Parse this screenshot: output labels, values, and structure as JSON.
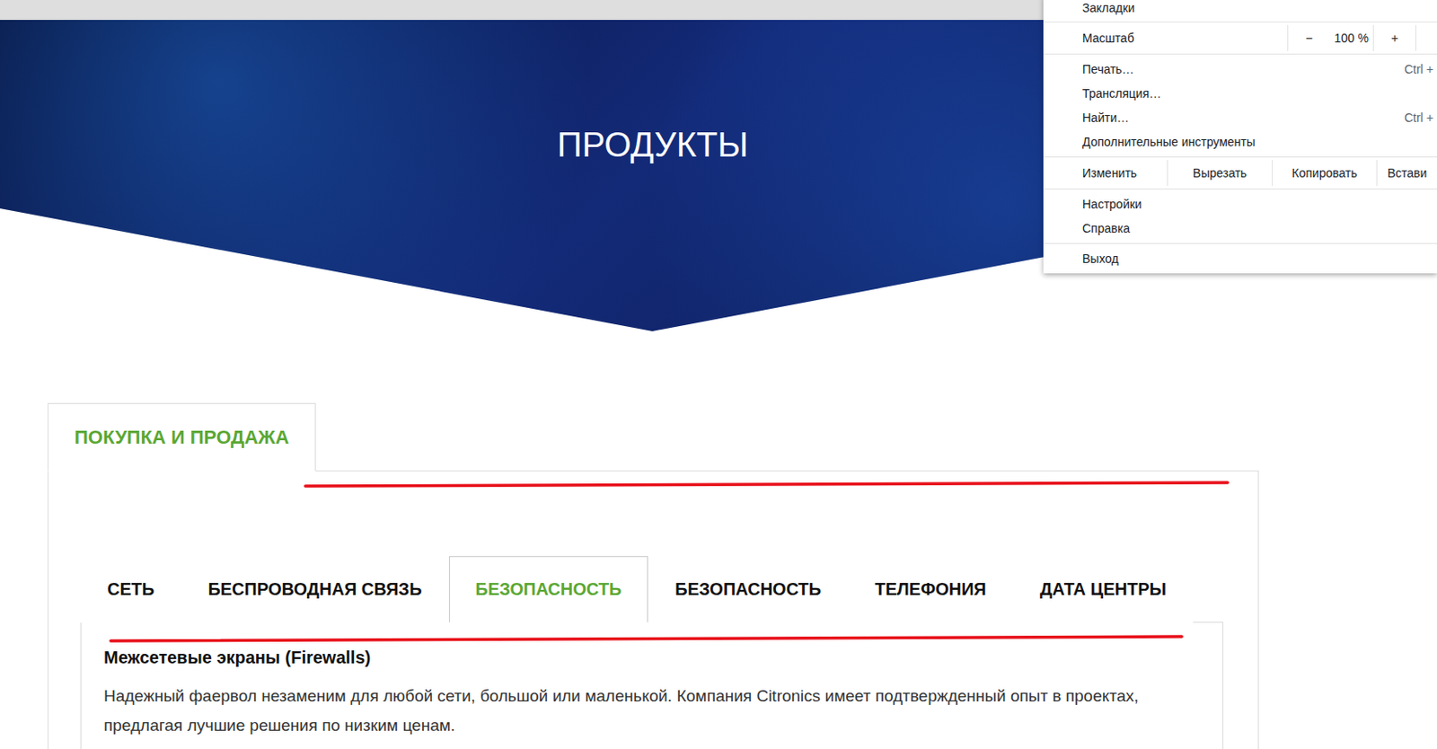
{
  "hero": {
    "title": "ПРОДУКТЫ"
  },
  "outer_tabs": [
    {
      "label": "ПОКУПКА И ПРОДАЖА",
      "selected": true
    }
  ],
  "inner_tabs": [
    {
      "label": "СЕТЬ",
      "selected": false
    },
    {
      "label": "БЕСПРОВОДНАЯ СВЯЗЬ",
      "selected": false
    },
    {
      "label": "БЕЗОПАСНОСТЬ",
      "selected": true
    },
    {
      "label": "БЕЗОПАСНОСТЬ",
      "selected": false
    },
    {
      "label": "ТЕЛЕФОНИЯ",
      "selected": false
    },
    {
      "label": "ДАТА ЦЕНТРЫ",
      "selected": false
    }
  ],
  "content": {
    "heading": "Межсетевые экраны (Firewalls)",
    "paragraph": "Надежный фаервол незаменим для любой сети, большой или маленькой. Компания Citronics имеет подтвержденный опыт в проектах, предлагая лучшие решения по низким ценам."
  },
  "browser_menu": {
    "groups": [
      [
        {
          "kind": "item",
          "label": "Закладки",
          "shortcut": ""
        }
      ],
      [
        {
          "kind": "zoom",
          "label": "Масштаб",
          "minus": "−",
          "value": "100 %",
          "plus": "+"
        }
      ],
      [
        {
          "kind": "item",
          "label": "Печать…",
          "shortcut": "Ctrl +"
        },
        {
          "kind": "item",
          "label": "Трансляция…",
          "shortcut": ""
        },
        {
          "kind": "item",
          "label": "Найти…",
          "shortcut": "Ctrl +"
        },
        {
          "kind": "item",
          "label": "Дополнительные инструменты",
          "shortcut": ""
        }
      ],
      [
        {
          "kind": "edit",
          "label": "Изменить",
          "actions": [
            "Вырезать",
            "Копировать",
            "Встави"
          ]
        }
      ],
      [
        {
          "kind": "item",
          "label": "Настройки",
          "shortcut": ""
        },
        {
          "kind": "item",
          "label": "Справка",
          "shortcut": ""
        }
      ],
      [
        {
          "kind": "item",
          "label": "Выход",
          "shortcut": ""
        }
      ]
    ]
  }
}
